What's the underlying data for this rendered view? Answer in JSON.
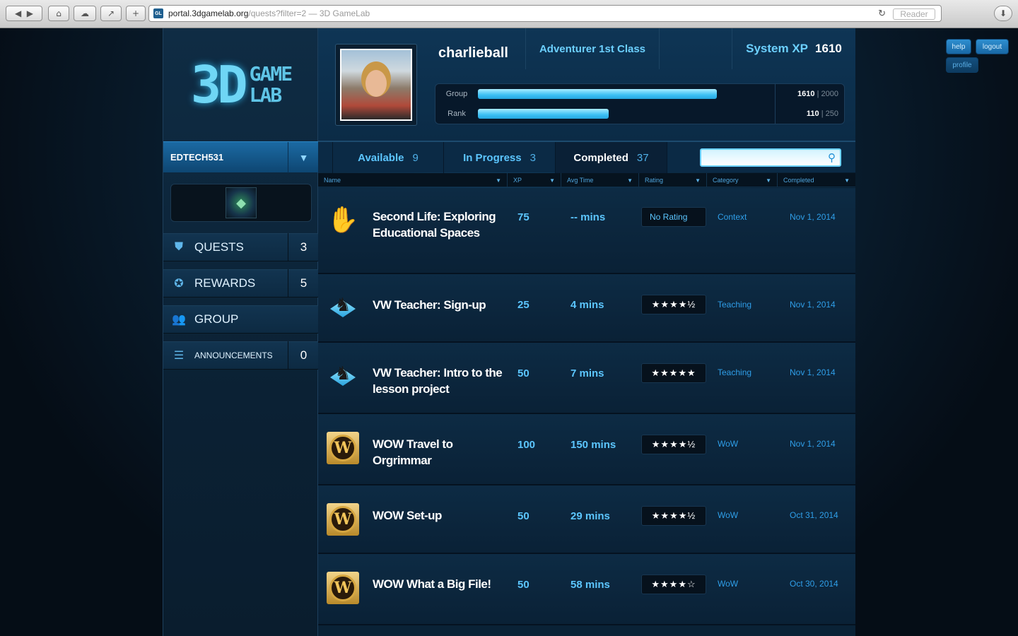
{
  "browser": {
    "url_host": "portal.3dgamelab.org",
    "url_path": "/quests?filter=2",
    "page_title": "— 3D GameLab",
    "reader_label": "Reader"
  },
  "top_links": {
    "help": "help",
    "logout": "logout",
    "profile": "profile"
  },
  "logo": {
    "big": "3D",
    "line1": "GAME",
    "line2": "LAB"
  },
  "sidebar": {
    "user": "EDTECH531",
    "nav": [
      {
        "label": "QUESTS",
        "count": "3"
      },
      {
        "label": "REWARDS",
        "count": "5"
      },
      {
        "label": "GROUP",
        "count": ""
      },
      {
        "label": "ANNOUNCEMENTS",
        "count": "0"
      }
    ]
  },
  "profile": {
    "username": "charlieball",
    "rank": "Adventurer 1st Class",
    "system_xp_label": "System XP",
    "system_xp": "1610",
    "group_label": "Group",
    "group_value": "1610",
    "group_max": "2000",
    "group_progress": 0.805,
    "rank_label": "Rank",
    "rank_value": "110",
    "rank_max": "250",
    "rank_progress": 0.44
  },
  "tabs": [
    {
      "label": "Available",
      "count": "9"
    },
    {
      "label": "In Progress",
      "count": "3"
    },
    {
      "label": "Completed",
      "count": "37"
    }
  ],
  "search": {
    "placeholder": ""
  },
  "columns": [
    "Name",
    "XP",
    "Avg Time",
    "Rating",
    "Category",
    "Completed"
  ],
  "quests": [
    {
      "icon": "second-life-hand-icon",
      "name": "Second Life: Exploring Educational Spaces",
      "xp": "75",
      "time": "-- mins",
      "rating": "No Rating",
      "category": "Context",
      "date": "Nov 1, 2014"
    },
    {
      "icon": "chess-knight-icon",
      "name": "VW Teacher: Sign-up",
      "xp": "25",
      "time": "4 mins",
      "rating": "★★★★½",
      "category": "Teaching",
      "date": "Nov 1, 2014"
    },
    {
      "icon": "chess-knight-icon",
      "name": "VW Teacher: Intro to the lesson project",
      "xp": "50",
      "time": "7 mins",
      "rating": "★★★★★",
      "category": "Teaching",
      "date": "Nov 1, 2014"
    },
    {
      "icon": "wow-logo-icon",
      "name": "WOW Travel to Orgrimmar",
      "xp": "100",
      "time": "150 mins",
      "rating": "★★★★½",
      "category": "WoW",
      "date": "Nov 1, 2014"
    },
    {
      "icon": "wow-logo-icon",
      "name": "WOW Set-up",
      "xp": "50",
      "time": "29 mins",
      "rating": "★★★★½",
      "category": "WoW",
      "date": "Oct 31, 2014"
    },
    {
      "icon": "wow-logo-icon",
      "name": "WOW What a Big File!",
      "xp": "50",
      "time": "58 mins",
      "rating": "★★★★☆",
      "category": "WoW",
      "date": "Oct 30, 2014"
    }
  ]
}
